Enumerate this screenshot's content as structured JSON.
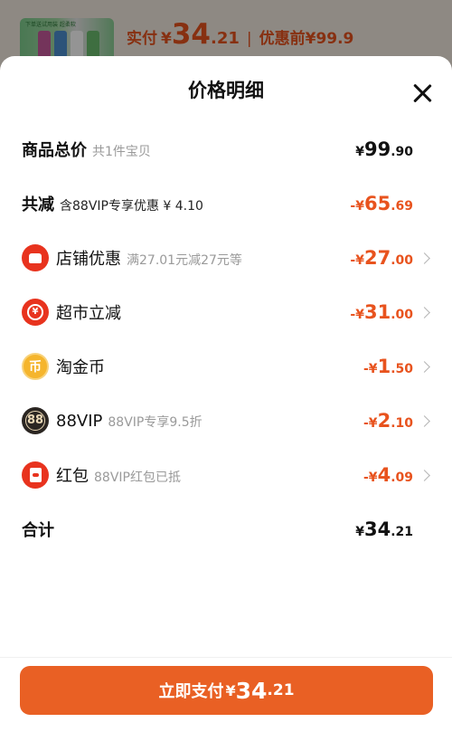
{
  "background": {
    "thumb_caption": "下单送试用装 超柔软",
    "paid_label": "实付",
    "currency": "¥",
    "paid_int": "34",
    "paid_dec": ".21",
    "separator": "|",
    "before_discount": "优惠前¥99.9"
  },
  "sheet": {
    "title": "价格明细"
  },
  "rows": [
    {
      "label": "商品总价",
      "sub": "共1件宝贝",
      "currency": "¥",
      "int": "99",
      "dec": ".90"
    },
    {
      "label": "共减",
      "sub": "含88VIP专享优惠 ¥ 4.10",
      "currency": "-¥",
      "int": "65",
      "dec": ".69"
    },
    {
      "icon": "store-icon",
      "label": "店铺优惠",
      "sub": "满27.01元减27元等",
      "currency": "-¥",
      "int": "27",
      "dec": ".00"
    },
    {
      "icon": "yuan-circle-icon",
      "label": "超市立减",
      "sub": "",
      "currency": "-¥",
      "int": "31",
      "dec": ".00"
    },
    {
      "icon": "coin-icon",
      "label": "淘金币",
      "sub": "",
      "currency": "-¥",
      "int": "1",
      "dec": ".50"
    },
    {
      "icon": "vip-88-icon",
      "label": "88VIP",
      "sub": "88VIP专享9.5折",
      "currency": "-¥",
      "int": "2",
      "dec": ".10"
    },
    {
      "icon": "red-packet-icon",
      "label": "红包",
      "sub": "88VIP红包已抵",
      "currency": "-¥",
      "int": "4",
      "dec": ".09"
    },
    {
      "label": "合计",
      "sub": "",
      "currency": "¥",
      "int": "34",
      "dec": ".21"
    }
  ],
  "icons": {
    "coin_glyph": "币",
    "vip_glyph": "88",
    "yuan_glyph": "¥"
  },
  "pay_button": {
    "label": "立即支付",
    "currency": "¥",
    "int": "34",
    "dec": ".21"
  },
  "colors": {
    "accent": "#e8531e",
    "button": "#e96024"
  }
}
